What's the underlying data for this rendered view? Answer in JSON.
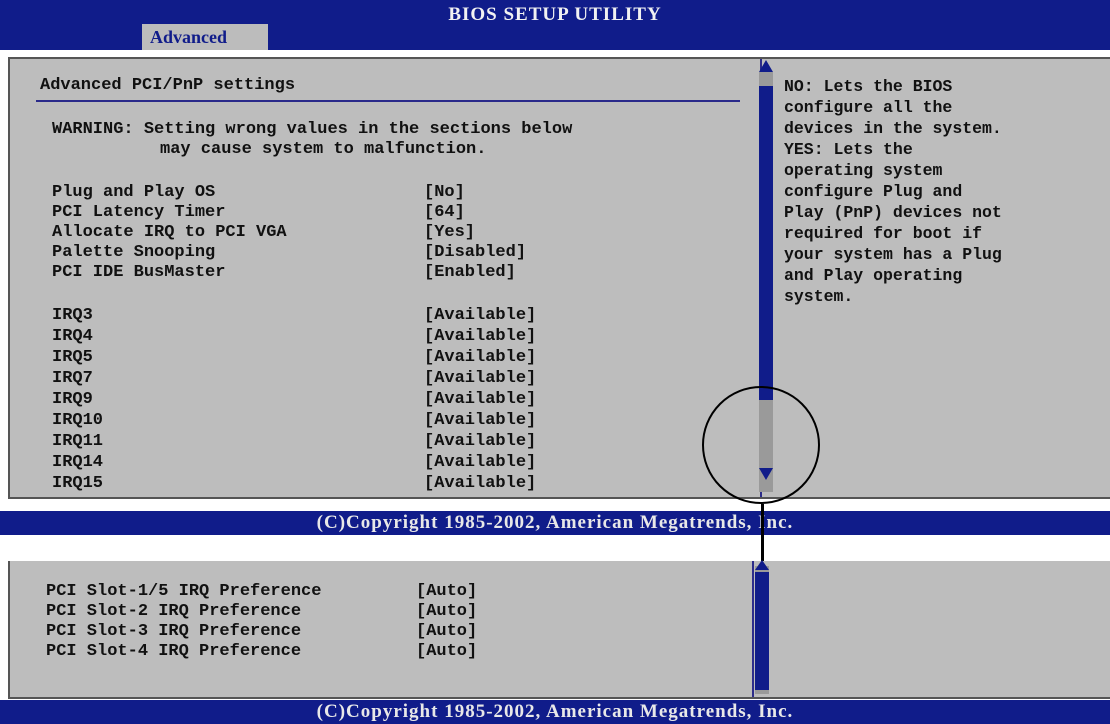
{
  "title": "BIOS SETUP UTILITY",
  "active_tab": "Advanced",
  "heading": "Advanced PCI/PnP settings",
  "warning": {
    "line1": "WARNING: Setting wrong values in the sections below",
    "line2": "may cause system to malfunction."
  },
  "settings": [
    {
      "label": "Plug and Play OS",
      "value": "[No]"
    },
    {
      "label": "PCI Latency Timer",
      "value": "[64]"
    },
    {
      "label": "Allocate IRQ to PCI VGA",
      "value": "[Yes]"
    },
    {
      "label": "Palette Snooping",
      "value": "[Disabled]"
    },
    {
      "label": "PCI IDE BusMaster",
      "value": "[Enabled]"
    }
  ],
  "irqs": [
    {
      "label": "IRQ3",
      "value": "[Available]"
    },
    {
      "label": "IRQ4",
      "value": "[Available]"
    },
    {
      "label": "IRQ5",
      "value": "[Available]"
    },
    {
      "label": "IRQ7",
      "value": "[Available]"
    },
    {
      "label": "IRQ9",
      "value": "[Available]"
    },
    {
      "label": "IRQ10",
      "value": "[Available]"
    },
    {
      "label": "IRQ11",
      "value": "[Available]"
    },
    {
      "label": "IRQ14",
      "value": "[Available]"
    },
    {
      "label": "IRQ15",
      "value": "[Available]"
    }
  ],
  "help_text": "NO: Lets the BIOS\nconfigure all the\ndevices in the system.\nYES: Lets the\noperating system\nconfigure Plug and\nPlay (PnP) devices not\nrequired for boot if\nyour system has a Plug\nand Play operating\nsystem.",
  "footer": "(C)Copyright 1985-2002, American Megatrends, Inc.",
  "slot_prefs": [
    {
      "label": "PCI Slot-1/5 IRQ Preference",
      "value": "[Auto]"
    },
    {
      "label": "PCI Slot-2 IRQ Preference",
      "value": "[Auto]"
    },
    {
      "label": "PCI Slot-3 IRQ Preference",
      "value": "[Auto]"
    },
    {
      "label": "PCI Slot-4 IRQ Preference",
      "value": "[Auto]"
    }
  ],
  "colors": {
    "bios_blue": "#101c8a",
    "panel_gray": "#bdbdbd",
    "text": "#111111"
  },
  "icons": [
    "scroll-up-arrow-icon",
    "scroll-down-arrow-icon"
  ]
}
